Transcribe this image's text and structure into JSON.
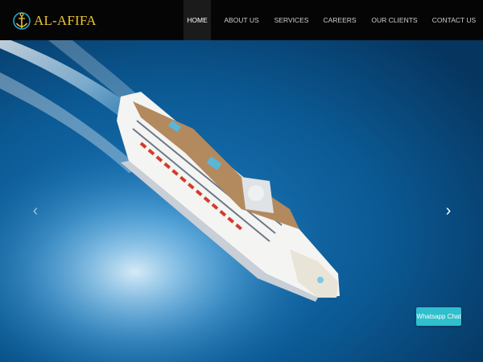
{
  "brand": {
    "name": "AL-AFIFA",
    "logo_icon": "anchor-icon",
    "accent": "#e8c534"
  },
  "nav": {
    "items": [
      {
        "label": "HOME",
        "active": true
      },
      {
        "label": "ABOUT US",
        "active": false
      },
      {
        "label": "SERVICES",
        "active": false
      },
      {
        "label": "CAREERS",
        "active": false
      },
      {
        "label": "OUR CLIENTS",
        "active": false
      },
      {
        "label": "CONTACT US",
        "active": false
      }
    ]
  },
  "carousel": {
    "prev_icon": "chevron-left-icon",
    "next_icon": "chevron-right-icon",
    "prev_glyph": "‹",
    "next_glyph": "›",
    "slide_image": "cruise-ship-aerial-photo"
  },
  "whatsapp": {
    "label": "Whatsapp Chat",
    "color": "#2fbfcd"
  }
}
